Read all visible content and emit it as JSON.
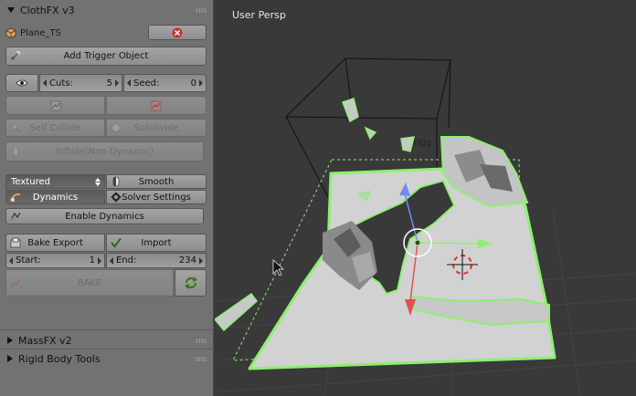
{
  "panel": {
    "clothfx_title": "ClothFX v3",
    "object_name": "Plane_TS",
    "add_trigger_label": "Add Trigger Object",
    "cuts_label": "Cuts:",
    "cuts_value": "5",
    "seed_label": "Seed:",
    "seed_value": "0",
    "self_collide_label": "Self Collide",
    "subdivide_label": "Subdivide",
    "inflate_label": "Inflate(Non-Dynamic)",
    "shading_value": "Textured",
    "smooth_label": "Smooth",
    "dynamics_label": "Dynamics",
    "solver_settings_label": "Solver Settings",
    "enable_dynamics_label": "Enable Dynamics",
    "bake_export_label": "Bake Export",
    "import_label": "Import",
    "start_label": "Start:",
    "start_value": "1",
    "end_label": "End:",
    "end_value": "234",
    "bake_label": "BAKE",
    "massfx_title": "MassFX v2",
    "rigid_body_title": "Rigid Body Tools"
  },
  "viewport": {
    "title": "User Persp",
    "trigger_label": "Trigg"
  },
  "colors": {
    "panel_bg": "#727272",
    "viewport_bg": "#393939",
    "grid_line": "#444444",
    "selection_outline": "#8cf070",
    "mesh_fill": "#d0d0d0",
    "axis_x": "#8cf070",
    "axis_y": "#e05050",
    "axis_z": "#6d8df0"
  }
}
